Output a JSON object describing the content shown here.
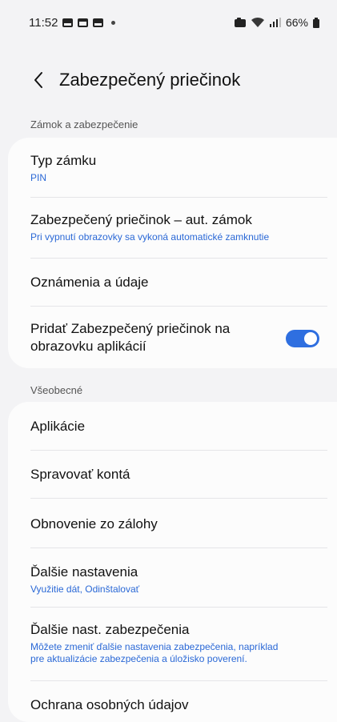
{
  "status_bar": {
    "time": "11:52",
    "battery": "66%"
  },
  "header": {
    "title": "Zabezpečený priečinok"
  },
  "sections": [
    {
      "label": "Zámok a zabezpečenie",
      "items": [
        {
          "title": "Typ zámku",
          "subtitle": "PIN"
        },
        {
          "title": "Zabezpečený priečinok – aut. zámok",
          "subtitle": "Pri vypnutí obrazovky sa vykoná automatické zamknutie"
        },
        {
          "title": "Oznámenia a údaje"
        },
        {
          "title_line1": "Pridať Zabezpečený priečinok na",
          "title_line2": "obrazovku aplikácií",
          "toggle_on": true
        }
      ]
    },
    {
      "label": "Všeobecné",
      "items": [
        {
          "title": "Aplikácie"
        },
        {
          "title": "Spravovať kontá"
        },
        {
          "title": "Obnovenie zo zálohy"
        },
        {
          "title": "Ďalšie nastavenia",
          "subtitle": "Využitie dát, Odinštalovať"
        },
        {
          "title": "Ďalšie nast. zabezpečenia",
          "subtitle_line1": "Môžete zmeniť ďalšie nastavenia zabezpečenia, napríklad",
          "subtitle_line2": "pre aktualizácie zabezpečenia a úložisko poverení."
        },
        {
          "title": "Ochrana osobných údajov"
        }
      ]
    }
  ],
  "colors": {
    "accent": "#2f6fe0",
    "subtitle": "#2a68d6",
    "background": "#f3f3f5",
    "card": "#fcfcfc"
  }
}
